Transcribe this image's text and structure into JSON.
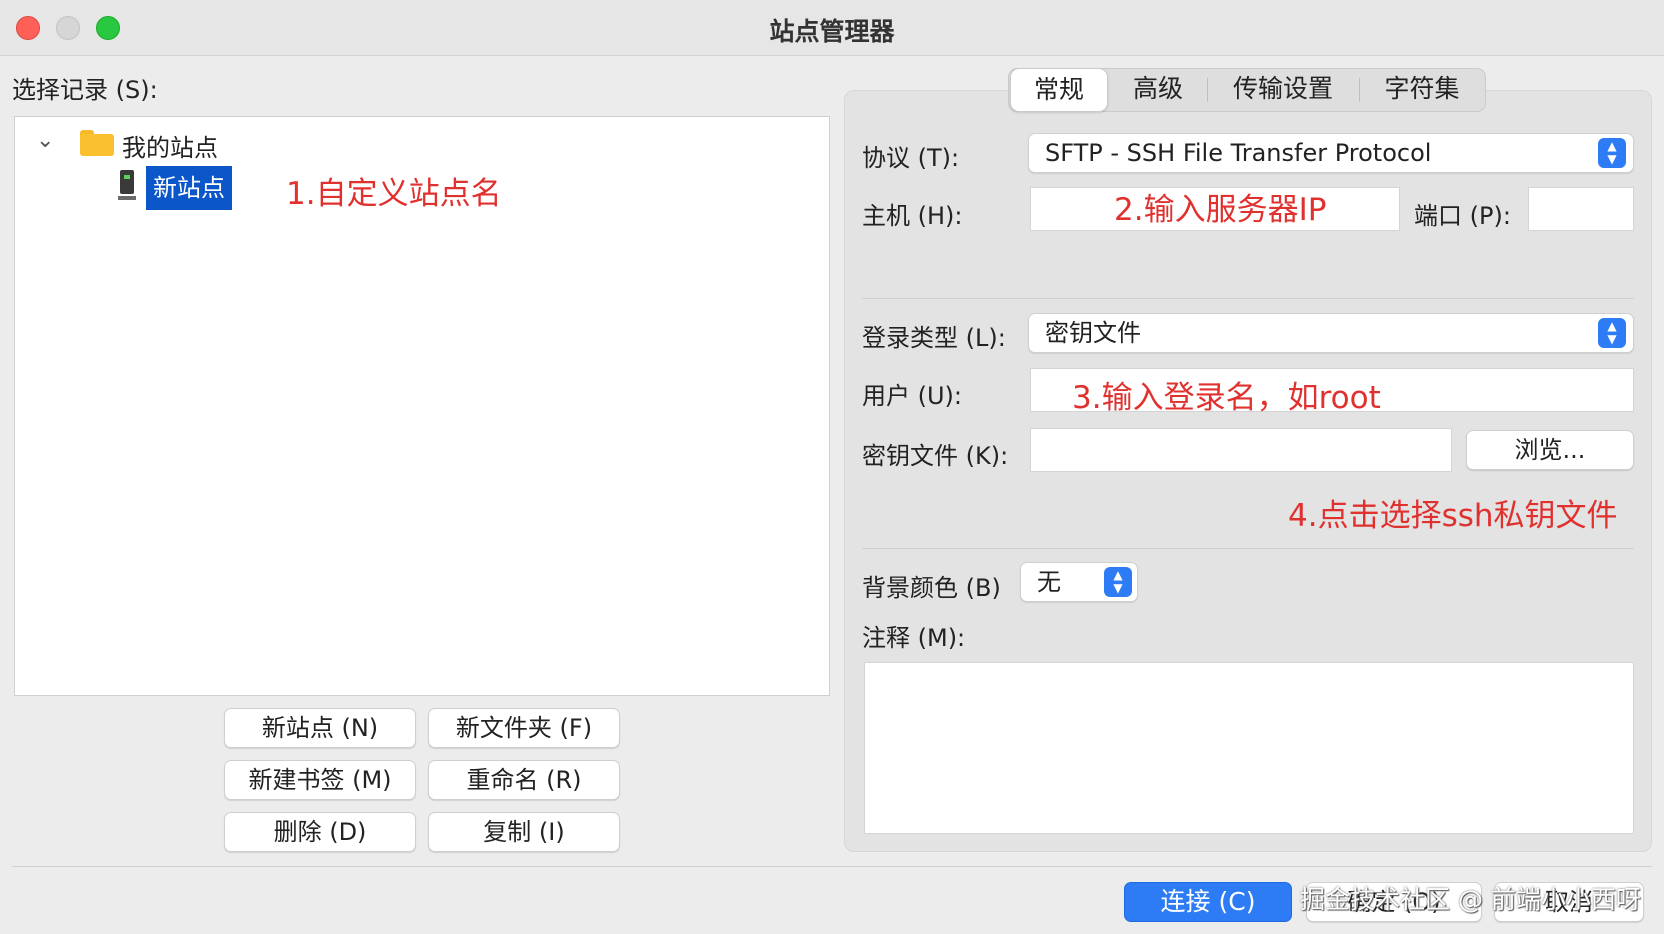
{
  "window": {
    "title": "站点管理器"
  },
  "left": {
    "select_label": "选择记录 (S):",
    "tree": {
      "folder_label": "我的站点",
      "site_label": "新站点"
    },
    "annotation": "1.自定义站点名",
    "buttons": {
      "new_site": "新站点 (N)",
      "new_folder": "新文件夹 (F)",
      "new_bookmark": "新建书签 (M)",
      "rename": "重命名 (R)",
      "delete": "删除 (D)",
      "copy": "复制 (I)"
    }
  },
  "tabs": [
    "常规",
    "高级",
    "传输设置",
    "字符集"
  ],
  "form": {
    "protocol_label": "协议 (T):",
    "protocol_value": "SFTP - SSH File Transfer Protocol",
    "host_label": "主机 (H):",
    "host_annotation": "2.输入服务器IP",
    "port_label": "端口 (P):",
    "logon_type_label": "登录类型 (L):",
    "logon_type_value": "密钥文件",
    "user_label": "用户 (U):",
    "user_annotation": "3.输入登录名，如root",
    "keyfile_label": "密钥文件 (K):",
    "browse_button": "浏览...",
    "keyfile_annotation": "4.点击选择ssh私钥文件",
    "bg_color_label": "背景颜色 (B)",
    "bg_color_value": "无",
    "comments_label": "注释 (M):"
  },
  "footer": {
    "connect_button": "连接 (C)",
    "ok_button": "确定 (O)",
    "cancel_button": "取消",
    "watermark": "掘金技术社区 @ 前端小小西呀"
  },
  "colors": {
    "accent": "#2d7cf6",
    "annotation": "#e0312f",
    "selection": "#0b56c9"
  }
}
